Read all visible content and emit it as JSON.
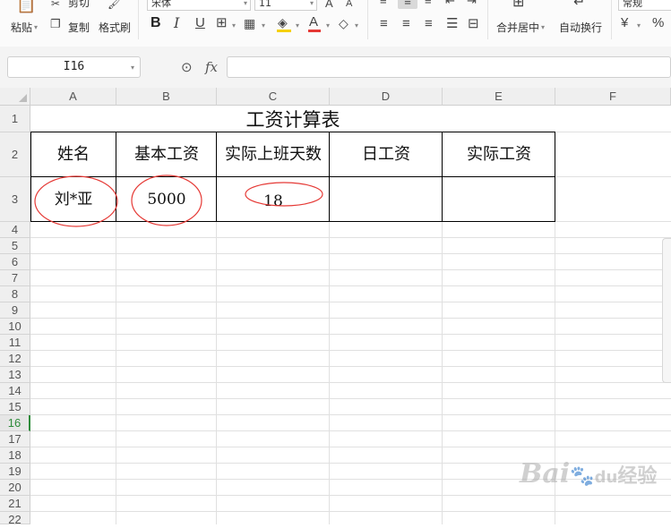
{
  "ribbon": {
    "paste_label": "粘贴",
    "cut_label": "剪切",
    "copy_label": "复制",
    "format_painter_label": "格式刷",
    "font_name": "宋体",
    "font_size": "11",
    "merge_center_label": "合并居中",
    "wrap_text_label": "自动换行",
    "number_format": "常规",
    "currency_symbol": "¥",
    "percent_symbol": "%",
    "bold_glyph": "B",
    "italic_glyph": "I",
    "underline_glyph": "U",
    "font_color_glyph": "A",
    "grow_font_glyph": "A",
    "shrink_font_glyph": "A",
    "dropdown_glyph": "▾",
    "font_color": "#e53935",
    "fill_color": "#f5d000"
  },
  "formula_bar": {
    "name_box": "I16",
    "fx_label": "fx",
    "zoom_icon": "magnifier-icon",
    "value": ""
  },
  "columns": [
    "A",
    "B",
    "C",
    "D",
    "E",
    "F"
  ],
  "rows": [
    "1",
    "2",
    "3",
    "4",
    "5",
    "6",
    "7",
    "8",
    "9",
    "10",
    "11",
    "12",
    "13",
    "14",
    "15",
    "16",
    "17",
    "18",
    "19",
    "20",
    "21",
    "22"
  ],
  "active_row": "16",
  "sheet": {
    "title": "工资计算表",
    "headers": [
      "姓名",
      "基本工资",
      "实际上班天数",
      "日工资",
      "实际工资"
    ],
    "row3": [
      "刘*亚",
      "5000",
      "18",
      "",
      ""
    ]
  },
  "annotations": {
    "ellipse_color": "#e53935"
  },
  "watermark": {
    "logo_text": "Bai",
    "paw": "du",
    "cn_text": "经验"
  }
}
